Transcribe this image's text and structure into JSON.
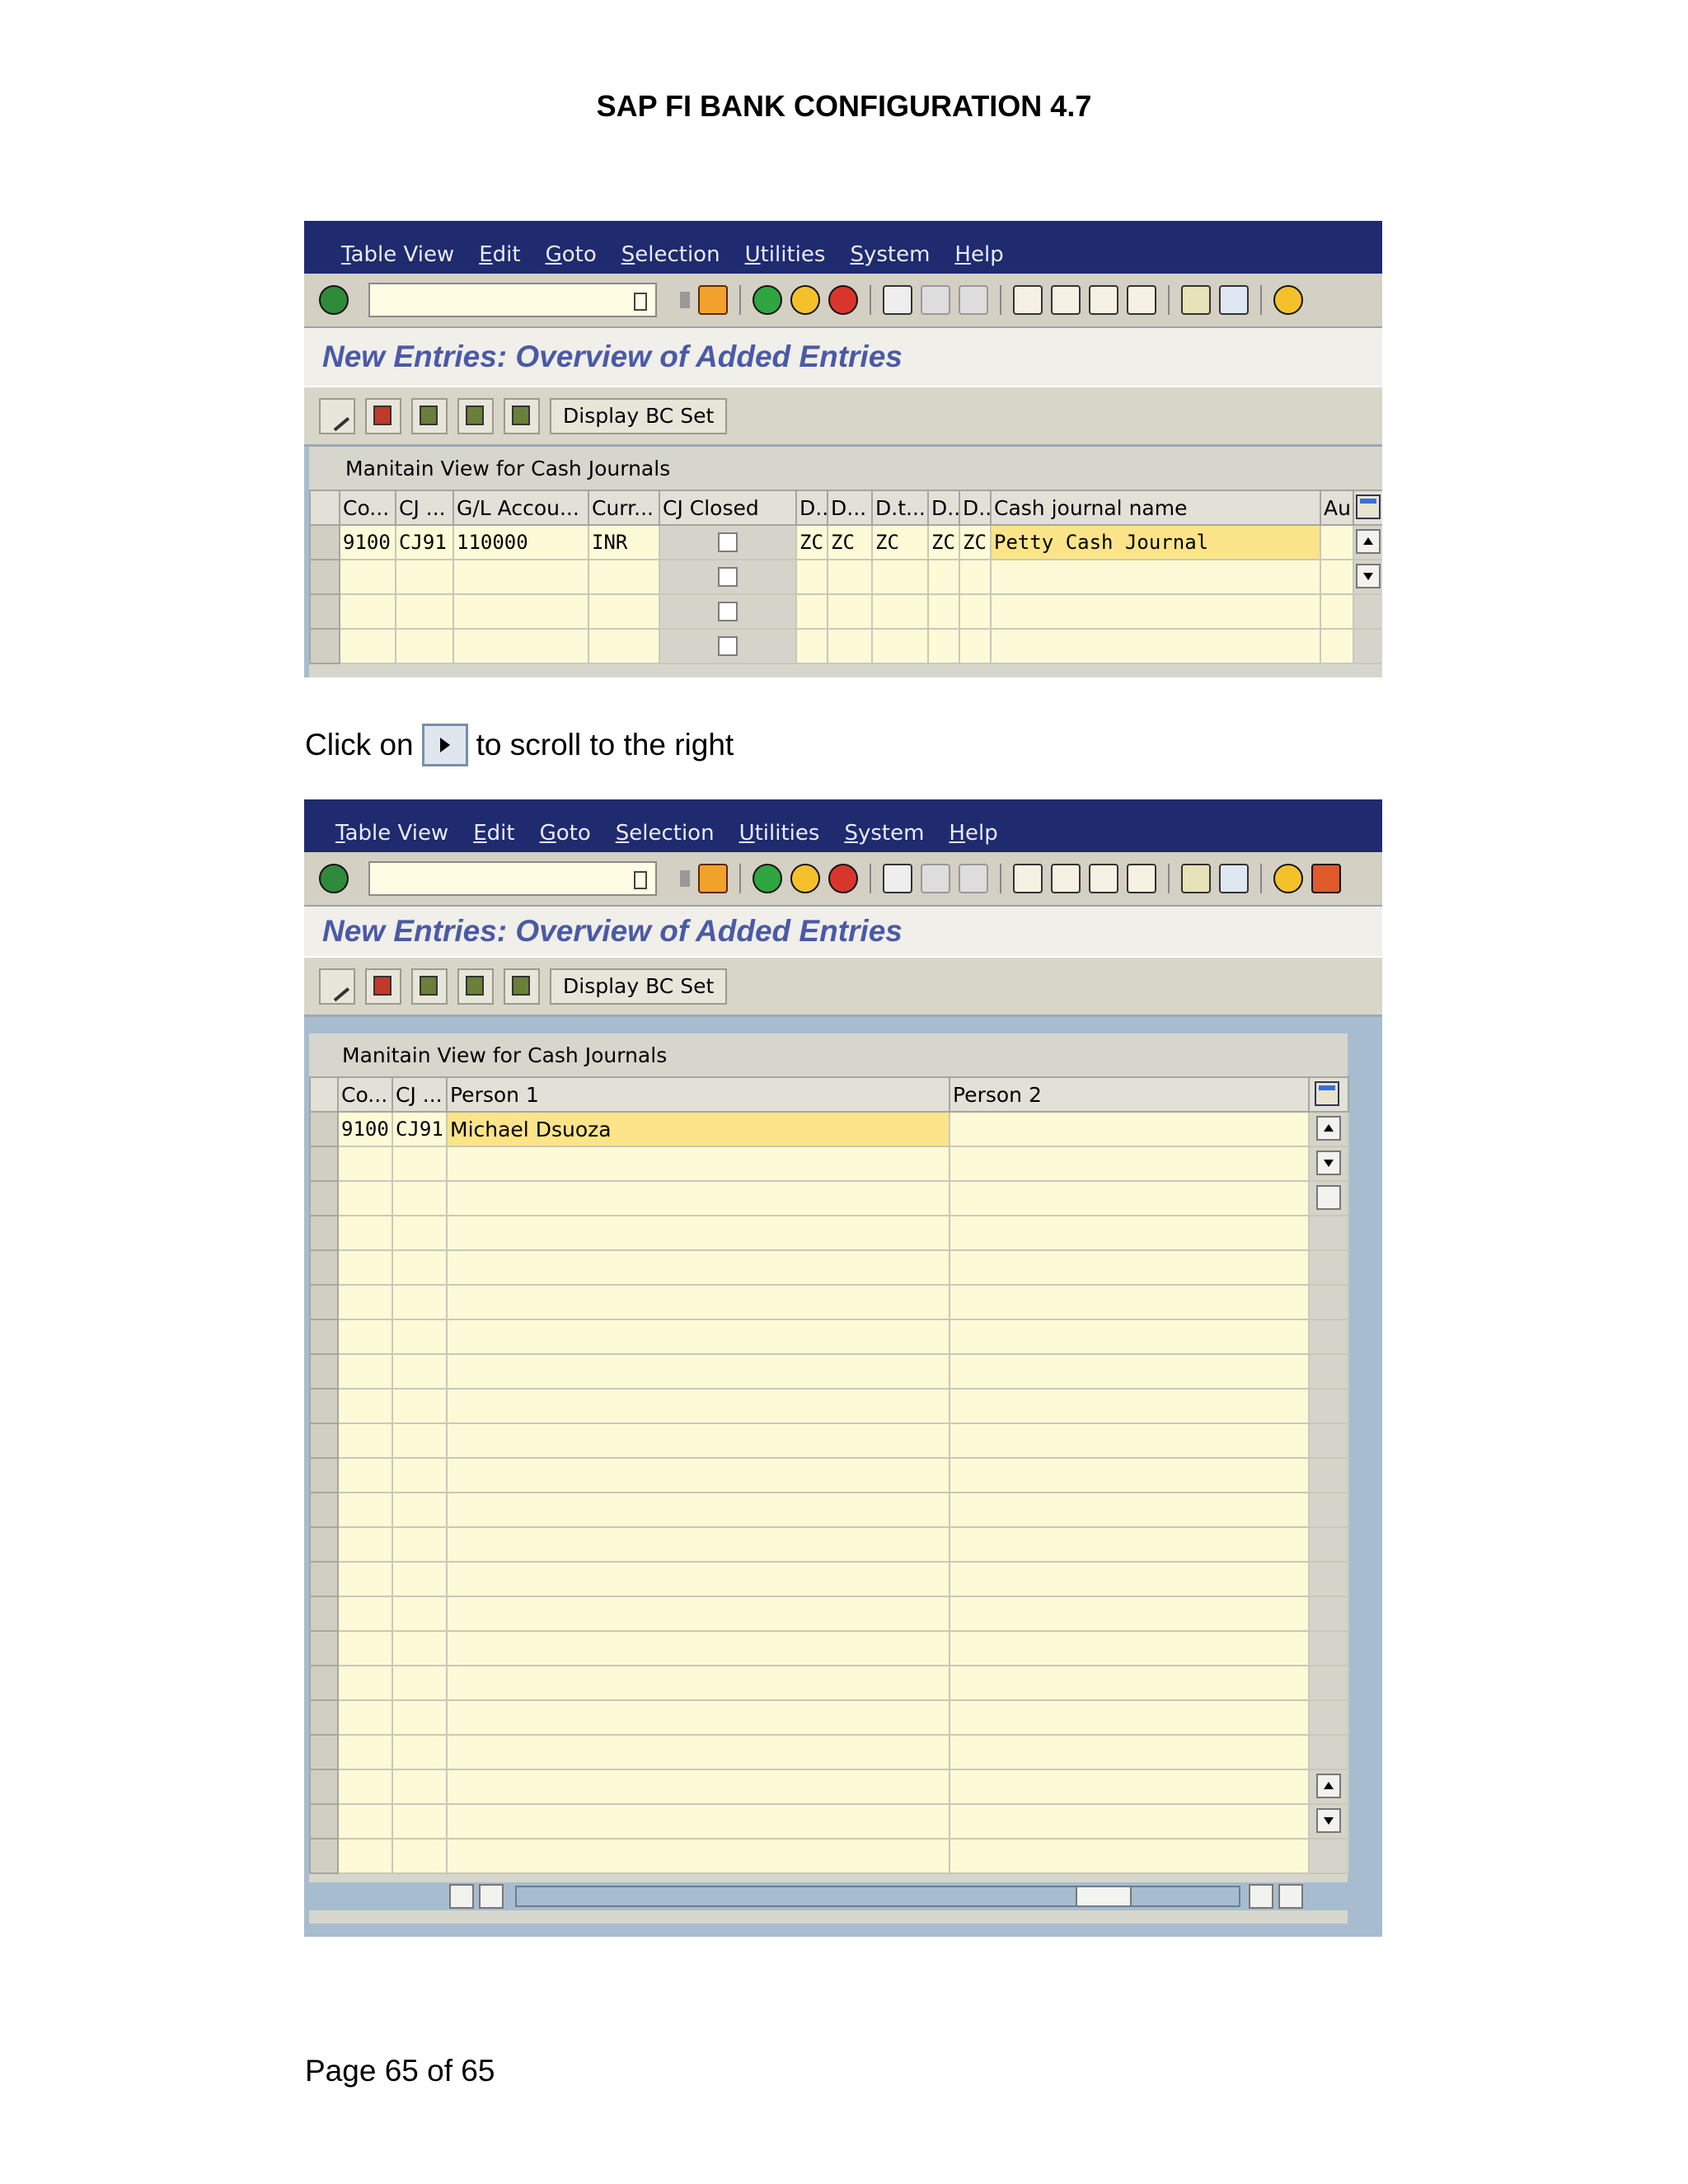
{
  "document": {
    "title": "SAP FI BANK CONFIGURATION 4.7",
    "instruction_before": "Click on",
    "instruction_after": "to scroll to the right",
    "footer": "Page 65 of 65"
  },
  "screen1": {
    "menu": [
      "Table View",
      "Edit",
      "Goto",
      "Selection",
      "Utilities",
      "System",
      "Help"
    ],
    "title": "New Entries: Overview of Added Entries",
    "bc_button": "Display BC Set",
    "table_caption": "Manitain View for Cash Journals",
    "columns": [
      "Co...",
      "CJ ...",
      "G/L Accou...",
      "Curr...",
      "CJ Closed",
      "D..",
      "D...",
      "D.t...",
      "D..",
      "D..",
      "Cash journal name",
      "Au"
    ],
    "row1": {
      "co": "9100",
      "cj": "CJ91",
      "gl": "110000",
      "curr": "INR",
      "d1": "ZC",
      "d2": "ZC",
      "d3": "ZC",
      "d4": "ZC",
      "d5": "ZC",
      "name": "Petty Cash Journal"
    }
  },
  "screen2": {
    "menu": [
      "Table View",
      "Edit",
      "Goto",
      "Selection",
      "Utilities",
      "System",
      "Help"
    ],
    "title": "New Entries: Overview of Added Entries",
    "bc_button": "Display BC Set",
    "table_caption": "Manitain View for Cash Journals",
    "columns": [
      "Co...",
      "CJ ...",
      "Person 1",
      "Person 2"
    ],
    "row1": {
      "co": "9100",
      "cj": "CJ91",
      "person1": "Michael Dsuoza",
      "person2": ""
    }
  },
  "colors": {
    "menubar": "#1f2a6f",
    "title": "#4b5aa6",
    "input_bg": "#fdfad8",
    "active_cell": "#fbe48a",
    "workarea": "#a8bccf"
  }
}
